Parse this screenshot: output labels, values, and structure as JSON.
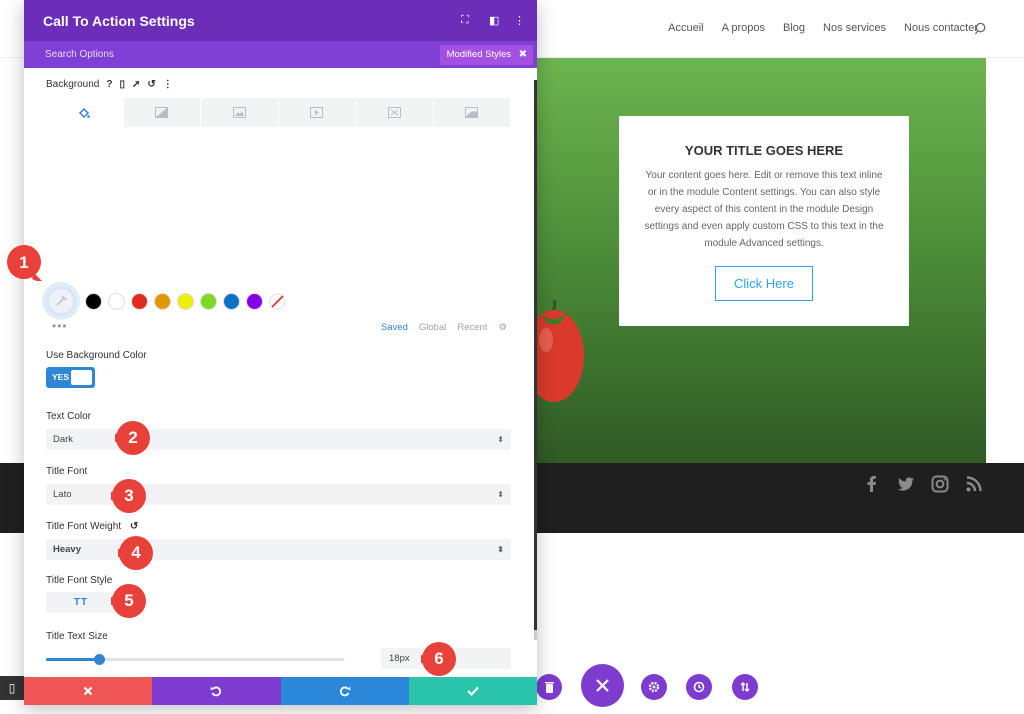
{
  "site": {
    "nav": [
      "Accueil",
      "A propos",
      "Blog",
      "Nos services",
      "Nous contacter"
    ],
    "cta": {
      "title": "YOUR TITLE GOES HERE",
      "body": "Your content goes here. Edit or remove this text inline or in the module Content settings. You can also style every aspect of this content in the module Design settings and even apply custom CSS to this text in the module Advanced settings.",
      "button": "Click Here"
    },
    "social_icons": [
      "facebook-icon",
      "twitter-icon",
      "instagram-icon",
      "rss-icon"
    ]
  },
  "panel": {
    "title": "Call To Action Settings",
    "search_placeholder": "Search Options",
    "modified_tag": "Modified Styles",
    "background_label": "Background",
    "bg_tab_icons": [
      "paint-bucket-icon",
      "gradient-icon",
      "image-icon",
      "video-icon",
      "pattern-icon",
      "mask-icon"
    ],
    "swatch_colors": [
      "#000000",
      "#ffffff",
      "#e02b20",
      "#e09900",
      "#edf000",
      "#7cda24",
      "#0c71c3",
      "#8300e9"
    ],
    "swatch_tabs": [
      "Saved",
      "Global",
      "Recent"
    ],
    "use_bg_color": {
      "label": "Use Background Color",
      "value": "YES"
    },
    "text_color": {
      "label": "Text Color",
      "value": "Dark"
    },
    "title_font": {
      "label": "Title Font",
      "value": "Lato"
    },
    "title_font_weight": {
      "label": "Title Font Weight",
      "value": "Heavy"
    },
    "title_font_style": {
      "label": "Title Font Style",
      "value": "TT"
    },
    "title_text_size": {
      "label": "Title Text Size",
      "value": "18px",
      "slider_fraction": 0.18
    }
  },
  "markers": [
    "1",
    "2",
    "3",
    "4",
    "5",
    "6"
  ],
  "colors": {
    "panel_header": "#6c2eb9",
    "panel_sub": "#7f3fd4",
    "accent": "#2e86d4",
    "cancel": "#ef5555",
    "undo": "#7e3bd0",
    "redo": "#2b87da",
    "save": "#29c4a9",
    "marker": "#e8413a"
  }
}
